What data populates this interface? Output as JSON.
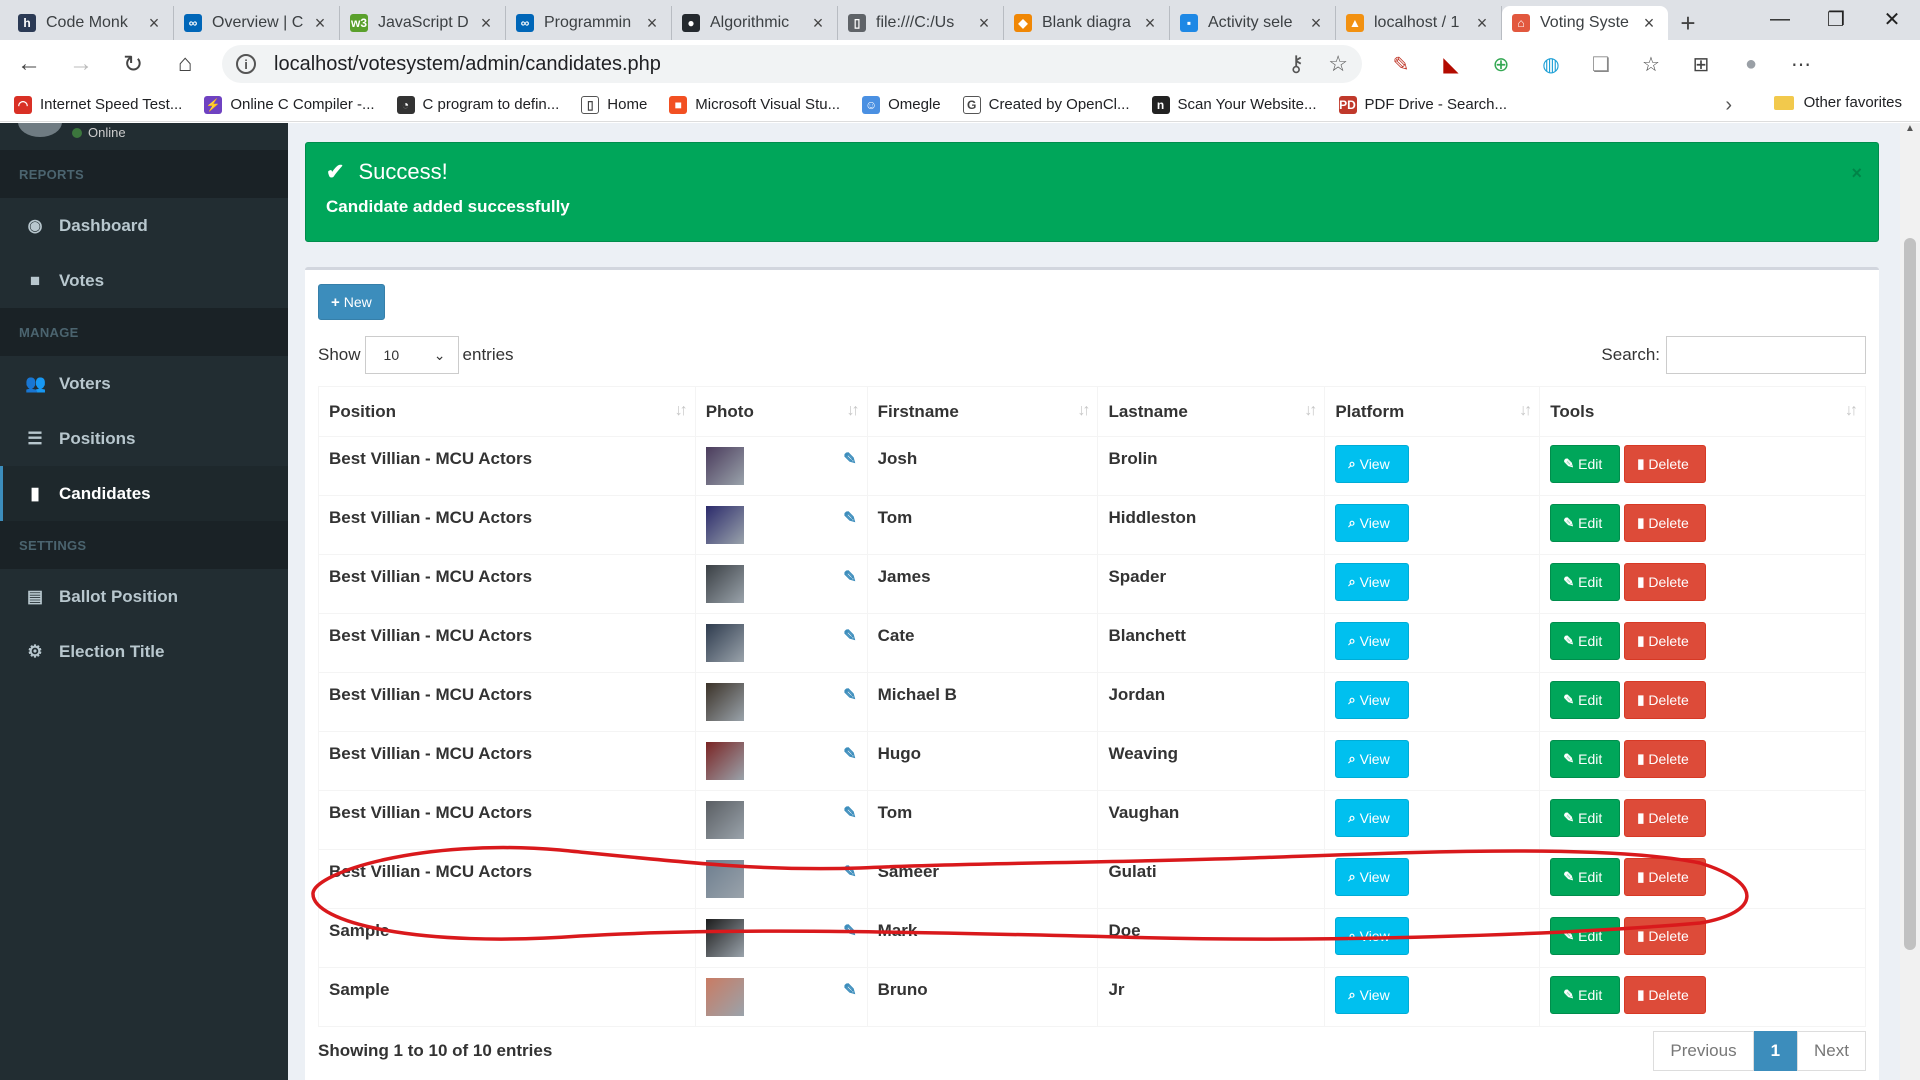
{
  "browser": {
    "tabs": [
      {
        "title": "Code Monk",
        "fav_color": "#2b3a55",
        "fav_glyph": "h"
      },
      {
        "title": "Overview | C",
        "fav_color": "#0066b8",
        "fav_glyph": "∞"
      },
      {
        "title": "JavaScript D",
        "fav_color": "#5aa02c",
        "fav_glyph": "w3"
      },
      {
        "title": "Programmin",
        "fav_color": "#0066b8",
        "fav_glyph": "∞"
      },
      {
        "title": "Algorithmic",
        "fav_color": "#24292e",
        "fav_glyph": "●"
      },
      {
        "title": "file:///C:/Us",
        "fav_color": "#5f6368",
        "fav_glyph": "▯"
      },
      {
        "title": "Blank diagra",
        "fav_color": "#f08705",
        "fav_glyph": "◆"
      },
      {
        "title": "Activity sele",
        "fav_color": "#1e88e5",
        "fav_glyph": "▪"
      },
      {
        "title": "localhost / 1",
        "fav_color": "#f29111",
        "fav_glyph": "▲"
      },
      {
        "title": "Voting Syste",
        "fav_color": "#e2583e",
        "fav_glyph": "⌂"
      }
    ],
    "url": "localhost/votesystem/admin/candidates.php",
    "bookmarks": [
      {
        "label": "Internet Speed Test...",
        "color": "#d93025",
        "glyph": "◠"
      },
      {
        "label": "Online C Compiler -...",
        "color": "#6f42c1",
        "glyph": "⚡"
      },
      {
        "label": "C program to defin...",
        "color": "#333333",
        "glyph": "◔"
      },
      {
        "label": "Home",
        "color": "#ffffff",
        "glyph": "▯"
      },
      {
        "label": "Microsoft Visual Stu...",
        "color": "#f25022",
        "glyph": "■"
      },
      {
        "label": "Omegle",
        "color": "#4a90e2",
        "glyph": "☺"
      },
      {
        "label": "Created by OpenCl...",
        "color": "#ffffff",
        "glyph": "G"
      },
      {
        "label": "Scan Your Website...",
        "color": "#222222",
        "glyph": "n"
      },
      {
        "label": "PDF Drive - Search...",
        "color": "#c0392b",
        "glyph": "PD"
      }
    ],
    "other_favorites": "Other favorites"
  },
  "sidebar": {
    "status": "Online",
    "sections": [
      {
        "header": "REPORTS",
        "items": [
          {
            "label": "Dashboard",
            "icon": "dashboard-icon",
            "glyph": "◉",
            "active": false
          },
          {
            "label": "Votes",
            "icon": "lock-icon",
            "glyph": "■",
            "active": false
          }
        ]
      },
      {
        "header": "MANAGE",
        "items": [
          {
            "label": "Voters",
            "icon": "users-icon",
            "glyph": "👥",
            "active": false
          },
          {
            "label": "Positions",
            "icon": "list-icon",
            "glyph": "☰",
            "active": false
          },
          {
            "label": "Candidates",
            "icon": "id-card-icon",
            "glyph": "▮",
            "active": true
          }
        ]
      },
      {
        "header": "SETTINGS",
        "items": [
          {
            "label": "Ballot Position",
            "icon": "file-icon",
            "glyph": "▤",
            "active": false
          },
          {
            "label": "Election Title",
            "icon": "cog-icon",
            "glyph": "⚙",
            "active": false
          }
        ]
      }
    ]
  },
  "alert": {
    "title": "Success!",
    "message": "Candidate added successfully",
    "close": "×",
    "color": "#00a65a"
  },
  "toolbar": {
    "new_label": "New"
  },
  "table_controls": {
    "show_label": "Show",
    "entries_value": "10",
    "entries_label": "entries",
    "search_label": "Search:"
  },
  "table": {
    "columns": [
      "Position",
      "Photo",
      "Firstname",
      "Lastname",
      "Platform",
      "Tools"
    ],
    "view_label": "View",
    "edit_label": "Edit",
    "delete_label": "Delete",
    "rows": [
      {
        "position": "Best Villian - MCU Actors",
        "firstname": "Josh",
        "lastname": "Brolin",
        "photo_color": "#4a3b5c"
      },
      {
        "position": "Best Villian - MCU Actors",
        "firstname": "Tom",
        "lastname": "Hiddleston",
        "photo_color": "#2b2a6b"
      },
      {
        "position": "Best Villian - MCU Actors",
        "firstname": "James",
        "lastname": "Spader",
        "photo_color": "#3a3f44"
      },
      {
        "position": "Best Villian - MCU Actors",
        "firstname": "Cate",
        "lastname": "Blanchett",
        "photo_color": "#2e3b4e"
      },
      {
        "position": "Best Villian - MCU Actors",
        "firstname": "Michael B",
        "lastname": "Jordan",
        "photo_color": "#3b3228"
      },
      {
        "position": "Best Villian - MCU Actors",
        "firstname": "Hugo",
        "lastname": "Weaving",
        "photo_color": "#7a2424"
      },
      {
        "position": "Best Villian - MCU Actors",
        "firstname": "Tom",
        "lastname": "Vaughan",
        "photo_color": "#5a5e63"
      },
      {
        "position": "Best Villian - MCU Actors",
        "firstname": "Sameer",
        "lastname": "Gulati",
        "photo_color": "#6d7e8f"
      },
      {
        "position": "Sample",
        "firstname": "Mark",
        "lastname": "Doe",
        "photo_color": "#1c1c1c"
      },
      {
        "position": "Sample",
        "firstname": "Bruno",
        "lastname": "Jr",
        "photo_color": "#c97b63"
      }
    ]
  },
  "footer": {
    "info": "Showing 1 to 10 of 10 entries",
    "previous": "Previous",
    "page": "1",
    "next": "Next"
  }
}
